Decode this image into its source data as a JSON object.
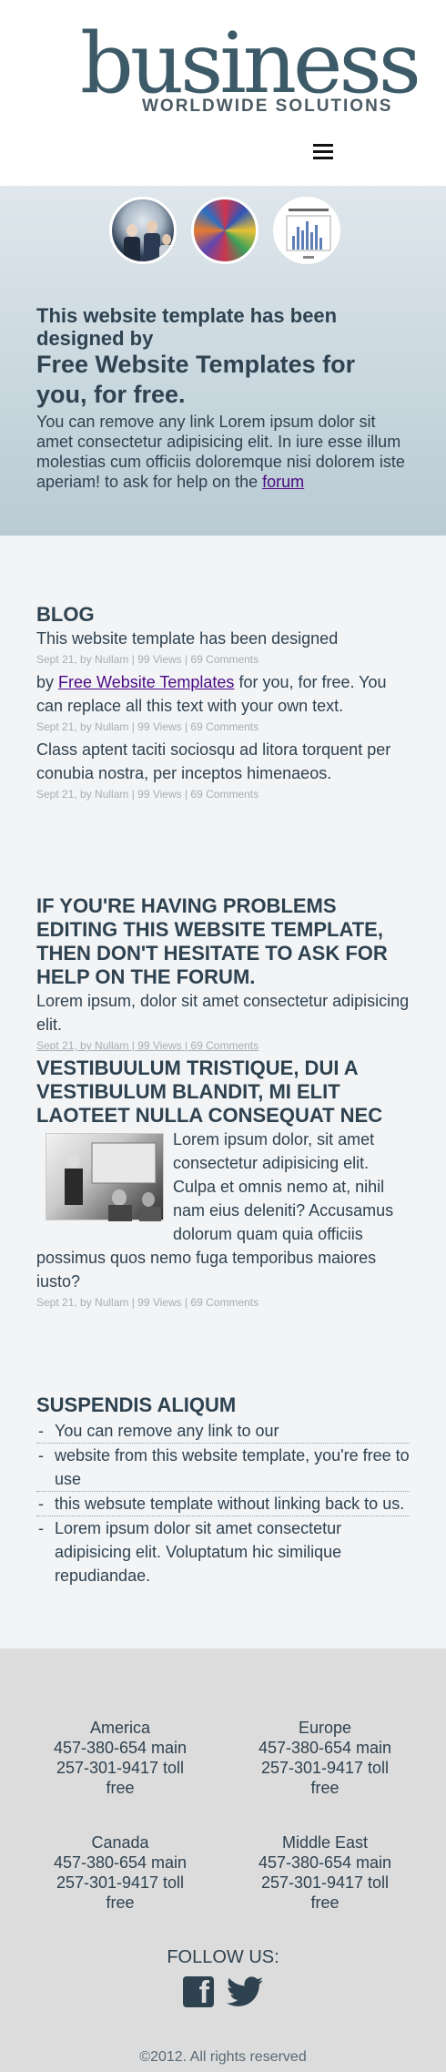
{
  "header": {
    "logo_word": "business",
    "logo_tagline": "WORLDWIDE SOLUTIONS",
    "menu_icon": "hamburger-menu-icon"
  },
  "hero": {
    "thumbs": [
      "people-meeting-image",
      "flags-image",
      "chart-document-image"
    ],
    "line1": "This website template has been designed by",
    "line2": "Free Website Templates for you, for free.",
    "body": "You can remove any link Lorem ipsum dolor sit amet consectetur adipisicing elit. In iure esse illum molestias cum officiis doloremque nisi dolorem iste aperiam! to ask for help on the",
    "link": "forum"
  },
  "blog": {
    "title": "BLOG",
    "posts": [
      {
        "text": "This website template has been designed",
        "meta": "Sept 21, by Nullam | 99 Views | 69 Comments"
      },
      {
        "pre": "by ",
        "link": "Free Website Templates",
        "post": " for you, for free. You can replace all this text with your own text.",
        "meta": "Sept 21, by Nullam | 99 Views | 69 Comments"
      },
      {
        "text": "Class aptent taciti sociosqu ad litora torquent per conubia nostra, per inceptos himenaeos.",
        "meta": "Sept 21, by Nullam | 99 Views | 69 Comments"
      }
    ]
  },
  "problems": {
    "title": "IF YOU'RE HAVING PROBLEMS EDITING THIS WEBSITE TEMPLATE, THEN DON'T HESITATE TO ASK FOR HELP ON THE FORUM.",
    "text": "Lorem ipsum, dolor sit amet consectetur adipisicing elit.",
    "meta": "Sept 21, by Nullam | 99 Views | 69 Comments"
  },
  "vest": {
    "title": "VESTIBUULUM TRISTIQUE, DUI A VESTIBULUM BLANDIT, MI ELIT LAOTEET NULLA CONSEQUAT NEC",
    "text": "Lorem ipsum dolor, sit amet consectetur adipisicing elit. Culpa et omnis nemo at, nihil nam eius deleniti? Accusamus dolorum quam quia officiis possimus quos nemo fuga temporibus maiores iusto?",
    "meta": "Sept 21, by Nullam | 99 Views | 69 Comments"
  },
  "suspendis": {
    "title": "SUSPENDIS ALIQUM",
    "items": [
      "You can remove any link to our",
      "website from this website template, you're free to use",
      "this websute template without linking back to us.",
      "Lorem ipsum dolor sit amet consectetur adipisicing elit. Voluptatum hic similique repudiandae."
    ]
  },
  "footer": {
    "offices": [
      {
        "name": "America",
        "line1": "457-380-654 main",
        "line2": "257-301-9417 toll free"
      },
      {
        "name": "Europe",
        "line1": "457-380-654 main",
        "line2": "257-301-9417 toll free"
      },
      {
        "name": "Canada",
        "line1": "457-380-654 main",
        "line2": "257-301-9417 toll free"
      },
      {
        "name": "Middle East",
        "line1": "457-380-654 main",
        "line2": "257-301-9417 toll free"
      }
    ],
    "follow": "FOLLOW US:",
    "social": [
      "facebook-icon",
      "twitter-icon"
    ],
    "copyright": "©2012. All rights reserved"
  },
  "colors": {
    "text": "#2f4250",
    "hero_top": "#dfe7ec",
    "hero_bottom": "#b9cbd4",
    "content_bg": "#f2f4f6",
    "footer_bg": "#dcdcdc",
    "link": "#4b0a82",
    "meta": "#a5aeb5"
  }
}
